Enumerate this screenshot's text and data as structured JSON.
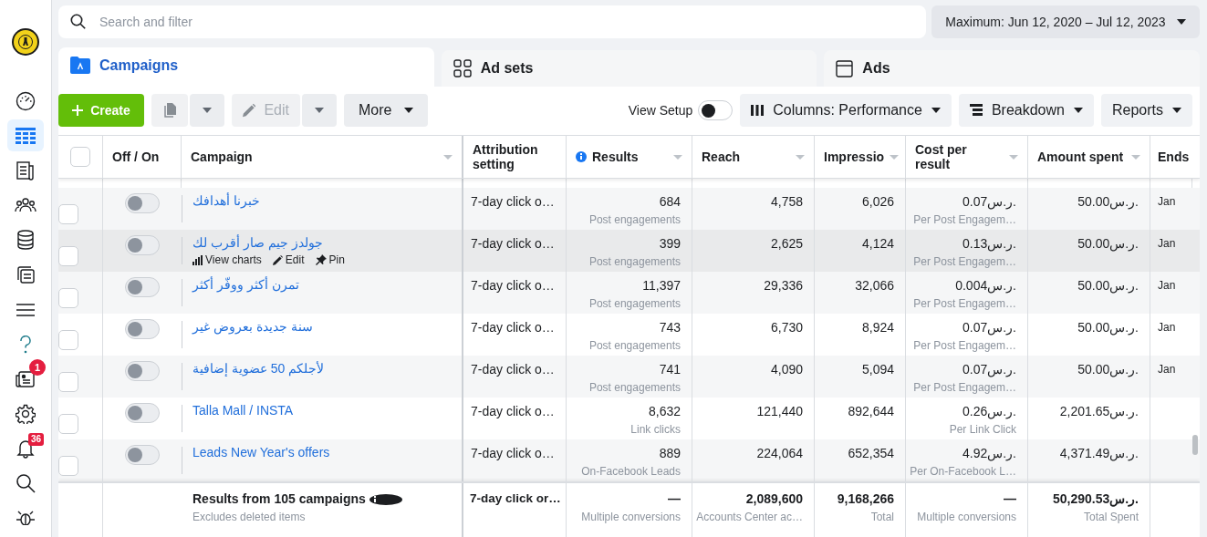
{
  "sidebar": [
    {
      "kind": "logo",
      "selected": false
    },
    {
      "kind": "gauge",
      "selected": false
    },
    {
      "kind": "table",
      "selected": true
    },
    {
      "kind": "pages",
      "selected": false
    },
    {
      "kind": "people",
      "selected": false
    },
    {
      "kind": "database",
      "selected": false
    },
    {
      "kind": "images",
      "selected": false
    },
    {
      "kind": "menu",
      "selected": false
    },
    {
      "kind": "help",
      "selected": false
    },
    {
      "kind": "news",
      "selected": false,
      "badge": "1"
    },
    {
      "kind": "settings",
      "selected": false
    },
    {
      "kind": "bell",
      "selected": false,
      "badge": "36"
    },
    {
      "kind": "search",
      "selected": false
    },
    {
      "kind": "bug",
      "selected": false
    }
  ],
  "search": {
    "placeholder": "Search and filter"
  },
  "date_range": "Maximum: Jun 12, 2020 – Jul 12, 2023",
  "tabs": [
    {
      "kind": "campaigns",
      "label": "Campaigns",
      "selected": true
    },
    {
      "kind": "adsets",
      "label": "Ad sets",
      "selected": false
    },
    {
      "kind": "ads",
      "label": "Ads",
      "selected": false
    }
  ],
  "toolbar": {
    "create": "Create",
    "duplicate_disabled": true,
    "edit": {
      "label": "Edit",
      "disabled": true
    },
    "more": "More",
    "view_setup": {
      "label": "View Setup",
      "on": false
    },
    "columns": "Columns: Performance",
    "breakdown": "Breakdown",
    "reports": "Reports"
  },
  "table": {
    "select_all": false,
    "columns": [
      {
        "label": "Off / On",
        "sortable": false,
        "info": false
      },
      {
        "label": "Campaign",
        "sortable": true,
        "info": false
      },
      {
        "label": "Attribution setting",
        "sortable": false,
        "info": false
      },
      {
        "label": "Results",
        "sortable": true,
        "info": true
      },
      {
        "label": "Reach",
        "sortable": true,
        "info": false
      },
      {
        "label": "Impressio",
        "sortable": true,
        "info": false
      },
      {
        "label": "Cost per result",
        "sortable": true,
        "info": false
      },
      {
        "label": "Amount spent",
        "sortable": true,
        "info": false
      },
      {
        "label": "Ends",
        "sortable": false,
        "info": false
      }
    ],
    "rows": [
      {
        "selected": false,
        "on": false,
        "hovered": false,
        "campaign": "خبرنا أهدافك",
        "attribution": "7-day click o…",
        "results": "684",
        "results_type": "Post engagements",
        "reach": "4,758",
        "impressions": "6,026",
        "cost": "0.07ر.س.",
        "cost_type": "Per Post Engagem…",
        "amount": "50.00ر.س.",
        "ends": "Jan"
      },
      {
        "selected": false,
        "on": false,
        "hovered": true,
        "campaign": "جولدز جيم صار أقرب لك",
        "actions": [
          {
            "kind": "chart",
            "label": "View charts"
          },
          {
            "kind": "edit",
            "label": "Edit"
          },
          {
            "kind": "pin",
            "label": "Pin"
          }
        ],
        "attribution": "7-day click o…",
        "results": "399",
        "results_type": "Post engagements",
        "reach": "2,625",
        "impressions": "4,124",
        "cost": "0.13ر.س.",
        "cost_type": "Per Post Engagem…",
        "amount": "50.00ر.س.",
        "ends": "Jan"
      },
      {
        "selected": false,
        "on": false,
        "hovered": false,
        "campaign": "تمرن أكثر ووفّر أكثر",
        "attribution": "7-day click o…",
        "results": "11,397",
        "results_type": "Post engagements",
        "reach": "29,336",
        "impressions": "32,066",
        "cost": "0.004ر.س.",
        "cost_type": "Per Post Engagem…",
        "amount": "50.00ر.س.",
        "ends": "Jan"
      },
      {
        "selected": false,
        "on": false,
        "hovered": false,
        "campaign": "سنة جديدة بعروض غير",
        "attribution": "7-day click o…",
        "results": "743",
        "results_type": "Post engagements",
        "reach": "6,730",
        "impressions": "8,924",
        "cost": "0.07ر.س.",
        "cost_type": "Per Post Engagem…",
        "amount": "50.00ر.س.",
        "ends": "Jan"
      },
      {
        "selected": false,
        "on": false,
        "hovered": false,
        "campaign": "لأجلكم 50 عضوية إضافية",
        "attribution": "7-day click o…",
        "results": "741",
        "results_type": "Post engagements",
        "reach": "4,090",
        "impressions": "5,094",
        "cost": "0.07ر.س.",
        "cost_type": "Per Post Engagem…",
        "amount": "50.00ر.س.",
        "ends": "Jan"
      },
      {
        "selected": false,
        "on": false,
        "hovered": false,
        "campaign": "Talla Mall / INSTA",
        "attribution": "7-day click o…",
        "results": "8,632",
        "results_type": "Link clicks",
        "reach": "121,440",
        "impressions": "892,644",
        "cost": "0.26ر.س.",
        "cost_type": "Per Link Click",
        "amount": "2,201.65ر.س."
      },
      {
        "selected": false,
        "on": false,
        "hovered": false,
        "campaign": "Leads New Year's offers",
        "attribution": "7-day click o…",
        "results": "889",
        "results_type": "On-Facebook Leads",
        "reach": "224,064",
        "impressions": "652,354",
        "cost": "4.92ر.س.",
        "cost_type": "Per On-Facebook L…",
        "amount": "4,371.49ر.س."
      }
    ],
    "summary": {
      "title": "Results from 105 campaigns",
      "note": "Excludes deleted items",
      "attribution": "7-day click or…",
      "results": "—",
      "results_type": "Multiple conversions",
      "reach": "2,089,600",
      "reach_type": "Accounts Center ac…",
      "impressions": "9,168,266",
      "impressions_type": "Total",
      "cost": "—",
      "cost_type": "Multiple conversions",
      "amount": "50,290.53ر.س.",
      "amount_type": "Total Spent"
    }
  }
}
